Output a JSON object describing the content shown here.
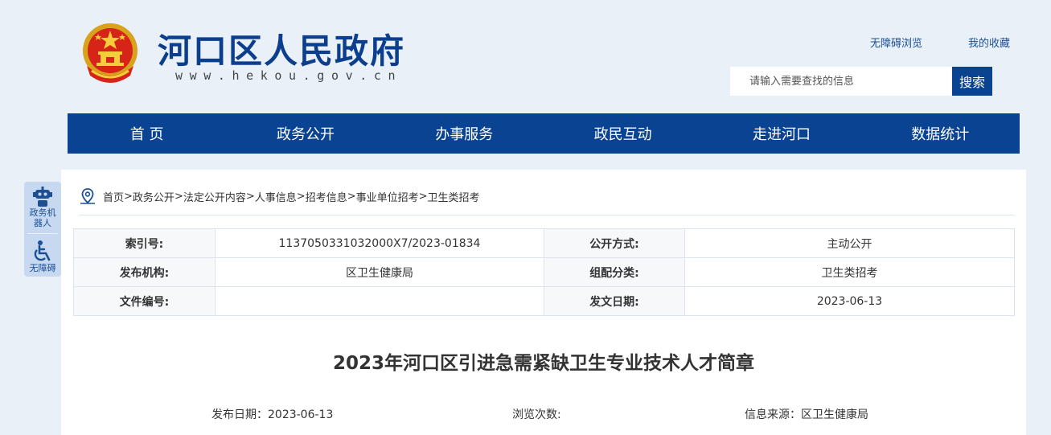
{
  "header": {
    "site_title": "河口区人民政府",
    "site_url": "www.hekou.gov.cn",
    "links": {
      "accessible_browse": "无障碍浏览",
      "my_favorites": "我的收藏"
    },
    "search": {
      "placeholder": "请输入需要查找的信息",
      "button_label": "搜索"
    }
  },
  "nav": {
    "items": [
      "首 页",
      "政务公开",
      "办事服务",
      "政民互动",
      "走进河口",
      "数据统计"
    ]
  },
  "side_tools": {
    "robot_label": "政务机器人",
    "accessible_label": "无障碍"
  },
  "breadcrumb": [
    "首页",
    "政务公开",
    "法定公开内容",
    "人事信息",
    "招考信息",
    "事业单位招考",
    "卫生类招考"
  ],
  "meta_table": {
    "rows": [
      {
        "k1": "索引号:",
        "v1": "11370503310320​00X7/2023-01834",
        "k2": "公开方式:",
        "v2": "主动公开"
      },
      {
        "k1": "发布机构:",
        "v1": "区卫生健康局",
        "k2": "组配分类:",
        "v2": "卫生类招考"
      },
      {
        "k1": "文件编号:",
        "v1": "",
        "k2": "发文日期:",
        "v2": "2023-06-13"
      }
    ]
  },
  "article": {
    "title": "2023年河口区引进急需紧缺卫生专业技术人才简章",
    "publish_date": "发布日期：2023-06-13",
    "views": "浏览次数:",
    "source": "信息来源：区卫生健康局"
  },
  "colors": {
    "brand_blue": "#0b4393",
    "page_bg": "#e9f0f8",
    "side_bg": "#c6d9f1"
  }
}
